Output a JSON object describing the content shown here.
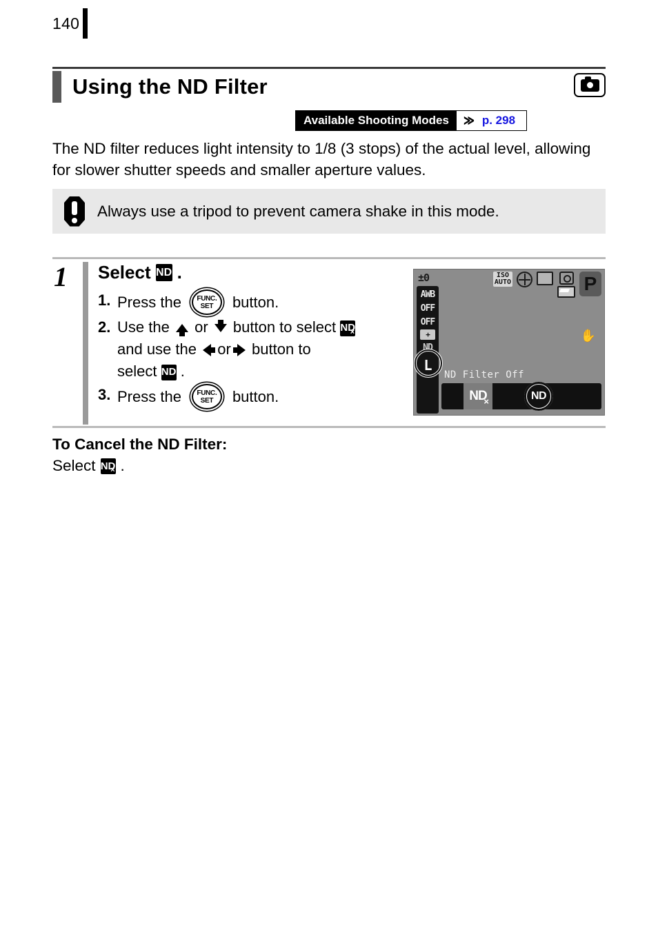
{
  "page": {
    "number": "140"
  },
  "header": {
    "title": "Using the ND Filter",
    "camera_icon": "camera-icon",
    "modes_label": "Available Shooting Modes",
    "modes_chevron": "≫",
    "modes_page_ref": "p. 298",
    "modes_page_ref_color": "#1515e0"
  },
  "intro": {
    "text": "The ND filter reduces light intensity to 1/8 (3 stops) of the actual level, allowing for slower shutter speeds and smaller aperture values."
  },
  "caution": {
    "icon": "exclamation-octagon-icon",
    "text": "Always use a tripod to prevent camera shake in this mode.",
    "background": "#e8e8e8"
  },
  "step": {
    "number": "1",
    "heading_prefix": "Select",
    "heading_icon": "ND",
    "heading_suffix": ".",
    "substeps": [
      {
        "num": "1.",
        "part1": "Press the",
        "button": "FUNC./SET",
        "part2": "button."
      },
      {
        "num": "2.",
        "part1": "Use the",
        "arrow_a": "up-arrow-icon",
        "or_a": "or",
        "arrow_b": "down-arrow-icon",
        "part2": "button to select",
        "icon_a": "ND-off",
        "part3": "and use the",
        "arrow_c": "left-arrow-icon",
        "or_b": "or",
        "arrow_d": "right-arrow-icon",
        "part4": "button to",
        "part5": "select",
        "icon_b": "ND",
        "part6": "."
      },
      {
        "num": "3.",
        "part1": "Press the",
        "button": "FUNC./SET",
        "part2": "button."
      }
    ]
  },
  "lcd": {
    "exposure_comp": "±0",
    "left_column": [
      {
        "name": "white-balance",
        "label": "AWB"
      },
      {
        "name": "flash-off",
        "label": "OFF"
      },
      {
        "name": "drive-off",
        "label": "OFF"
      },
      {
        "name": "exposure-plus",
        "label": "+"
      },
      {
        "name": "nd-filter",
        "label": "ND"
      },
      {
        "name": "image-size",
        "label": "L"
      }
    ],
    "iso_top": "ISO",
    "iso_bottom": "AUTO",
    "globe_icon": "metering-globe-icon",
    "frame_icon": "frame-icon",
    "camera_icon": "camera-icon",
    "battery_icon": "battery-icon",
    "shooting_mode": "P",
    "hand_icon": "✋",
    "status_text": "ND Filter Off",
    "bottom_option_off": "ND",
    "bottom_option_on": "ND"
  },
  "cancel": {
    "heading": "To Cancel the ND Filter:",
    "prefix": "Select",
    "icon": "ND-off",
    "suffix": "."
  }
}
